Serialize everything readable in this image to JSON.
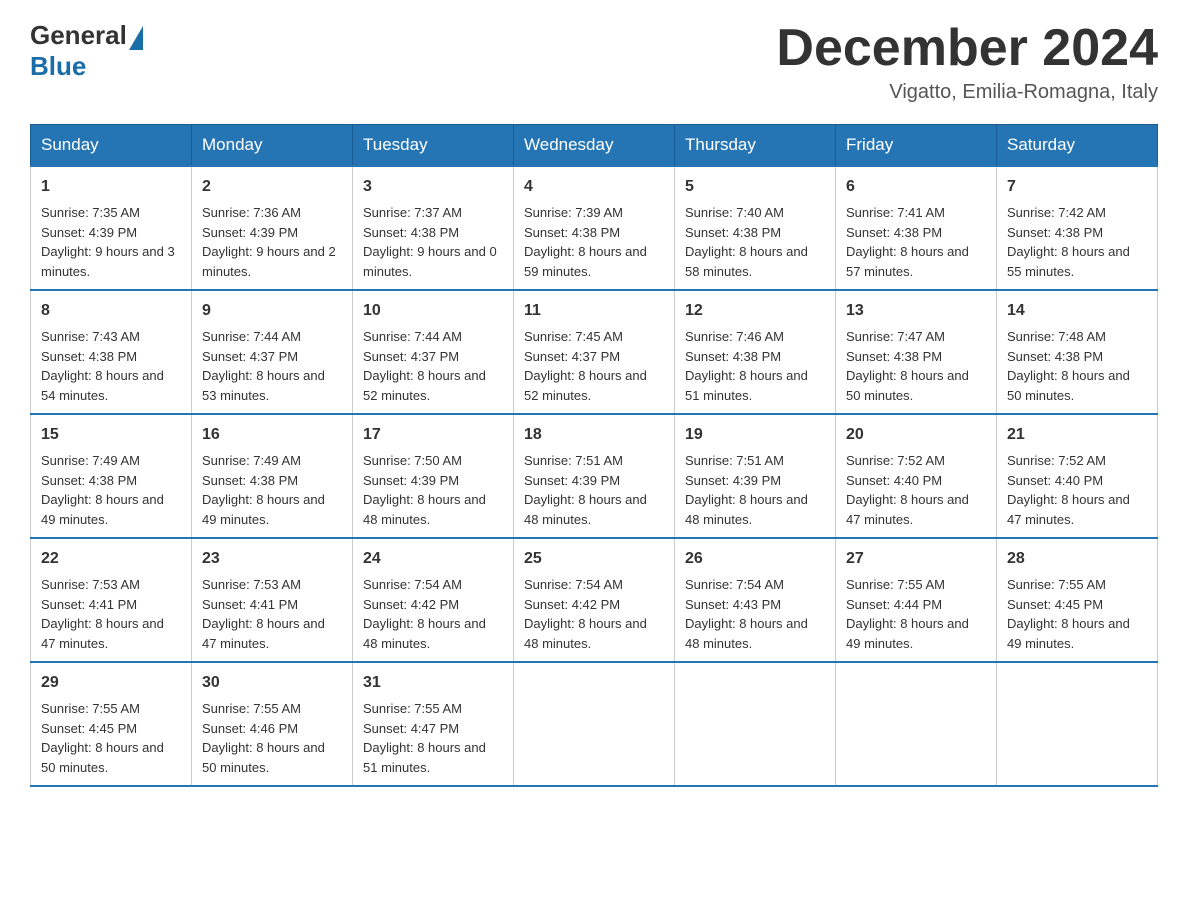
{
  "header": {
    "logo_general": "General",
    "logo_blue": "Blue",
    "month_title": "December 2024",
    "location": "Vigatto, Emilia-Romagna, Italy"
  },
  "days_of_week": [
    "Sunday",
    "Monday",
    "Tuesday",
    "Wednesday",
    "Thursday",
    "Friday",
    "Saturday"
  ],
  "weeks": [
    [
      {
        "day": "1",
        "sunrise": "7:35 AM",
        "sunset": "4:39 PM",
        "daylight": "9 hours and 3 minutes."
      },
      {
        "day": "2",
        "sunrise": "7:36 AM",
        "sunset": "4:39 PM",
        "daylight": "9 hours and 2 minutes."
      },
      {
        "day": "3",
        "sunrise": "7:37 AM",
        "sunset": "4:38 PM",
        "daylight": "9 hours and 0 minutes."
      },
      {
        "day": "4",
        "sunrise": "7:39 AM",
        "sunset": "4:38 PM",
        "daylight": "8 hours and 59 minutes."
      },
      {
        "day": "5",
        "sunrise": "7:40 AM",
        "sunset": "4:38 PM",
        "daylight": "8 hours and 58 minutes."
      },
      {
        "day": "6",
        "sunrise": "7:41 AM",
        "sunset": "4:38 PM",
        "daylight": "8 hours and 57 minutes."
      },
      {
        "day": "7",
        "sunrise": "7:42 AM",
        "sunset": "4:38 PM",
        "daylight": "8 hours and 55 minutes."
      }
    ],
    [
      {
        "day": "8",
        "sunrise": "7:43 AM",
        "sunset": "4:38 PM",
        "daylight": "8 hours and 54 minutes."
      },
      {
        "day": "9",
        "sunrise": "7:44 AM",
        "sunset": "4:37 PM",
        "daylight": "8 hours and 53 minutes."
      },
      {
        "day": "10",
        "sunrise": "7:44 AM",
        "sunset": "4:37 PM",
        "daylight": "8 hours and 52 minutes."
      },
      {
        "day": "11",
        "sunrise": "7:45 AM",
        "sunset": "4:37 PM",
        "daylight": "8 hours and 52 minutes."
      },
      {
        "day": "12",
        "sunrise": "7:46 AM",
        "sunset": "4:38 PM",
        "daylight": "8 hours and 51 minutes."
      },
      {
        "day": "13",
        "sunrise": "7:47 AM",
        "sunset": "4:38 PM",
        "daylight": "8 hours and 50 minutes."
      },
      {
        "day": "14",
        "sunrise": "7:48 AM",
        "sunset": "4:38 PM",
        "daylight": "8 hours and 50 minutes."
      }
    ],
    [
      {
        "day": "15",
        "sunrise": "7:49 AM",
        "sunset": "4:38 PM",
        "daylight": "8 hours and 49 minutes."
      },
      {
        "day": "16",
        "sunrise": "7:49 AM",
        "sunset": "4:38 PM",
        "daylight": "8 hours and 49 minutes."
      },
      {
        "day": "17",
        "sunrise": "7:50 AM",
        "sunset": "4:39 PM",
        "daylight": "8 hours and 48 minutes."
      },
      {
        "day": "18",
        "sunrise": "7:51 AM",
        "sunset": "4:39 PM",
        "daylight": "8 hours and 48 minutes."
      },
      {
        "day": "19",
        "sunrise": "7:51 AM",
        "sunset": "4:39 PM",
        "daylight": "8 hours and 48 minutes."
      },
      {
        "day": "20",
        "sunrise": "7:52 AM",
        "sunset": "4:40 PM",
        "daylight": "8 hours and 47 minutes."
      },
      {
        "day": "21",
        "sunrise": "7:52 AM",
        "sunset": "4:40 PM",
        "daylight": "8 hours and 47 minutes."
      }
    ],
    [
      {
        "day": "22",
        "sunrise": "7:53 AM",
        "sunset": "4:41 PM",
        "daylight": "8 hours and 47 minutes."
      },
      {
        "day": "23",
        "sunrise": "7:53 AM",
        "sunset": "4:41 PM",
        "daylight": "8 hours and 47 minutes."
      },
      {
        "day": "24",
        "sunrise": "7:54 AM",
        "sunset": "4:42 PM",
        "daylight": "8 hours and 48 minutes."
      },
      {
        "day": "25",
        "sunrise": "7:54 AM",
        "sunset": "4:42 PM",
        "daylight": "8 hours and 48 minutes."
      },
      {
        "day": "26",
        "sunrise": "7:54 AM",
        "sunset": "4:43 PM",
        "daylight": "8 hours and 48 minutes."
      },
      {
        "day": "27",
        "sunrise": "7:55 AM",
        "sunset": "4:44 PM",
        "daylight": "8 hours and 49 minutes."
      },
      {
        "day": "28",
        "sunrise": "7:55 AM",
        "sunset": "4:45 PM",
        "daylight": "8 hours and 49 minutes."
      }
    ],
    [
      {
        "day": "29",
        "sunrise": "7:55 AM",
        "sunset": "4:45 PM",
        "daylight": "8 hours and 50 minutes."
      },
      {
        "day": "30",
        "sunrise": "7:55 AM",
        "sunset": "4:46 PM",
        "daylight": "8 hours and 50 minutes."
      },
      {
        "day": "31",
        "sunrise": "7:55 AM",
        "sunset": "4:47 PM",
        "daylight": "8 hours and 51 minutes."
      },
      null,
      null,
      null,
      null
    ]
  ]
}
